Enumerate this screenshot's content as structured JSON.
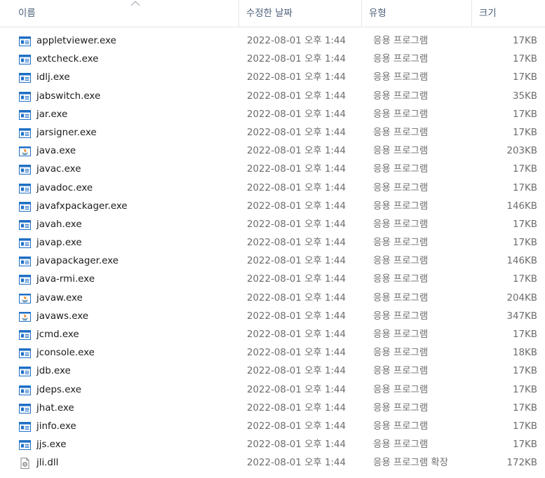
{
  "columns": {
    "name": "이름",
    "date": "수정한 날짜",
    "type": "유형",
    "size": "크기"
  },
  "colors": {
    "header_text": "#4c607a",
    "icon_blue": "#1f6fc5",
    "secondary_text": "#6d6d6d"
  },
  "files": [
    {
      "name": "appletviewer.exe",
      "date": "2022-08-01 오후 1:44",
      "type": "응용 프로그램",
      "size": "17KB",
      "icon": "exe-icon"
    },
    {
      "name": "extcheck.exe",
      "date": "2022-08-01 오후 1:44",
      "type": "응용 프로그램",
      "size": "17KB",
      "icon": "exe-icon"
    },
    {
      "name": "idlj.exe",
      "date": "2022-08-01 오후 1:44",
      "type": "응용 프로그램",
      "size": "17KB",
      "icon": "exe-icon"
    },
    {
      "name": "jabswitch.exe",
      "date": "2022-08-01 오후 1:44",
      "type": "응용 프로그램",
      "size": "35KB",
      "icon": "exe-icon"
    },
    {
      "name": "jar.exe",
      "date": "2022-08-01 오후 1:44",
      "type": "응용 프로그램",
      "size": "17KB",
      "icon": "exe-icon"
    },
    {
      "name": "jarsigner.exe",
      "date": "2022-08-01 오후 1:44",
      "type": "응용 프로그램",
      "size": "17KB",
      "icon": "exe-icon"
    },
    {
      "name": "java.exe",
      "date": "2022-08-01 오후 1:44",
      "type": "응용 프로그램",
      "size": "203KB",
      "icon": "java-icon"
    },
    {
      "name": "javac.exe",
      "date": "2022-08-01 오후 1:44",
      "type": "응용 프로그램",
      "size": "17KB",
      "icon": "exe-icon"
    },
    {
      "name": "javadoc.exe",
      "date": "2022-08-01 오후 1:44",
      "type": "응용 프로그램",
      "size": "17KB",
      "icon": "exe-icon"
    },
    {
      "name": "javafxpackager.exe",
      "date": "2022-08-01 오후 1:44",
      "type": "응용 프로그램",
      "size": "146KB",
      "icon": "exe-icon"
    },
    {
      "name": "javah.exe",
      "date": "2022-08-01 오후 1:44",
      "type": "응용 프로그램",
      "size": "17KB",
      "icon": "exe-icon"
    },
    {
      "name": "javap.exe",
      "date": "2022-08-01 오후 1:44",
      "type": "응용 프로그램",
      "size": "17KB",
      "icon": "exe-icon"
    },
    {
      "name": "javapackager.exe",
      "date": "2022-08-01 오후 1:44",
      "type": "응용 프로그램",
      "size": "146KB",
      "icon": "exe-icon"
    },
    {
      "name": "java-rmi.exe",
      "date": "2022-08-01 오후 1:44",
      "type": "응용 프로그램",
      "size": "17KB",
      "icon": "exe-icon"
    },
    {
      "name": "javaw.exe",
      "date": "2022-08-01 오후 1:44",
      "type": "응용 프로그램",
      "size": "204KB",
      "icon": "java-icon"
    },
    {
      "name": "javaws.exe",
      "date": "2022-08-01 오후 1:44",
      "type": "응용 프로그램",
      "size": "347KB",
      "icon": "java-icon"
    },
    {
      "name": "jcmd.exe",
      "date": "2022-08-01 오후 1:44",
      "type": "응용 프로그램",
      "size": "17KB",
      "icon": "exe-icon"
    },
    {
      "name": "jconsole.exe",
      "date": "2022-08-01 오후 1:44",
      "type": "응용 프로그램",
      "size": "18KB",
      "icon": "exe-icon"
    },
    {
      "name": "jdb.exe",
      "date": "2022-08-01 오후 1:44",
      "type": "응용 프로그램",
      "size": "17KB",
      "icon": "exe-icon"
    },
    {
      "name": "jdeps.exe",
      "date": "2022-08-01 오후 1:44",
      "type": "응용 프로그램",
      "size": "17KB",
      "icon": "exe-icon"
    },
    {
      "name": "jhat.exe",
      "date": "2022-08-01 오후 1:44",
      "type": "응용 프로그램",
      "size": "17KB",
      "icon": "exe-icon"
    },
    {
      "name": "jinfo.exe",
      "date": "2022-08-01 오후 1:44",
      "type": "응용 프로그램",
      "size": "17KB",
      "icon": "exe-icon"
    },
    {
      "name": "jjs.exe",
      "date": "2022-08-01 오후 1:44",
      "type": "응용 프로그램",
      "size": "17KB",
      "icon": "exe-icon"
    },
    {
      "name": "jli.dll",
      "date": "2022-08-01 오후 1:44",
      "type": "응용 프로그램 확장",
      "size": "172KB",
      "icon": "dll-icon"
    }
  ]
}
